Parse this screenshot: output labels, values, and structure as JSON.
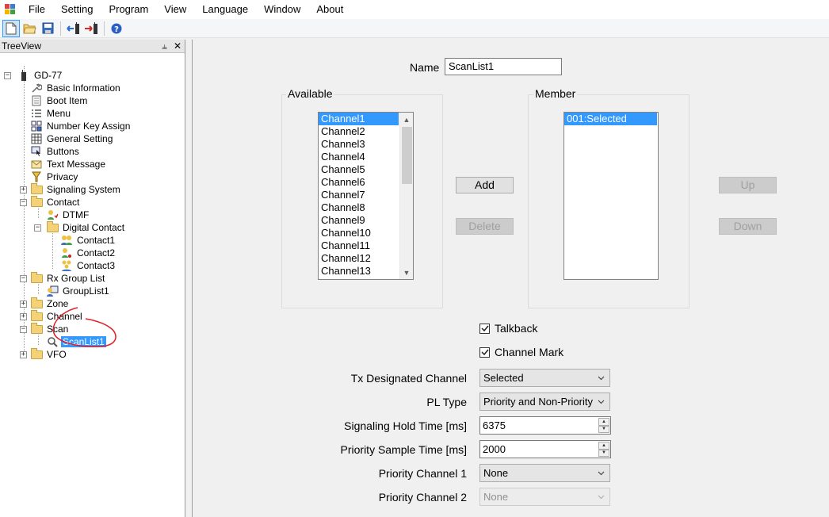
{
  "menu": [
    "File",
    "Setting",
    "Program",
    "View",
    "Language",
    "Window",
    "About"
  ],
  "toolbar": {
    "icons": [
      "new-file-icon",
      "open-folder-icon",
      "save-icon",
      "read-from-radio-icon",
      "write-to-radio-icon",
      "help-icon"
    ]
  },
  "tree": {
    "title": "TreeView",
    "pin_glyph": "⫨",
    "close_glyph": "✕",
    "root": "GD-77",
    "nodes": {
      "basic_information": "Basic Information",
      "boot_item": "Boot Item",
      "menu": "Menu",
      "number_key_assign": "Number Key Assign",
      "general_setting": "General Setting",
      "buttons": "Buttons",
      "text_message": "Text Message",
      "privacy": "Privacy",
      "signaling_system": "Signaling System",
      "contact": "Contact",
      "dtmf": "DTMF",
      "digital_contact": "Digital Contact",
      "contact1": "Contact1",
      "contact2": "Contact2",
      "contact3": "Contact3",
      "rx_group_list": "Rx Group List",
      "grouplist1": "GroupList1",
      "zone": "Zone",
      "channel": "Channel",
      "scan": "Scan",
      "scanlist1": "ScanList1",
      "vfo": "VFO"
    }
  },
  "form": {
    "name_label": "Name",
    "name_value": "ScanList1",
    "available_title": "Available",
    "available_items": [
      "Channel1",
      "Channel2",
      "Channel3",
      "Channel4",
      "Channel5",
      "Channel6",
      "Channel7",
      "Channel8",
      "Channel9",
      "Channel10",
      "Channel11",
      "Channel12",
      "Channel13"
    ],
    "available_selected_index": 0,
    "member_title": "Member",
    "member_items": [
      "001:Selected"
    ],
    "add_label": "Add",
    "delete_label": "Delete",
    "up_label": "Up",
    "down_label": "Down",
    "talkback_label": "Talkback",
    "talkback_checked": true,
    "channel_mark_label": "Channel Mark",
    "channel_mark_checked": true,
    "tx_designated_label": "Tx Designated Channel",
    "tx_designated_value": "Selected",
    "pl_type_label": "PL Type",
    "pl_type_value": "Priority and Non-Priority",
    "signaling_hold_label": "Signaling Hold Time [ms]",
    "signaling_hold_value": "6375",
    "priority_sample_label": "Priority Sample Time [ms]",
    "priority_sample_value": "2000",
    "priority_ch1_label": "Priority Channel 1",
    "priority_ch1_value": "None",
    "priority_ch2_label": "Priority Channel 2",
    "priority_ch2_value": "None"
  },
  "colors": {
    "selection": "#3399ff",
    "annotation": "#e0202a"
  }
}
